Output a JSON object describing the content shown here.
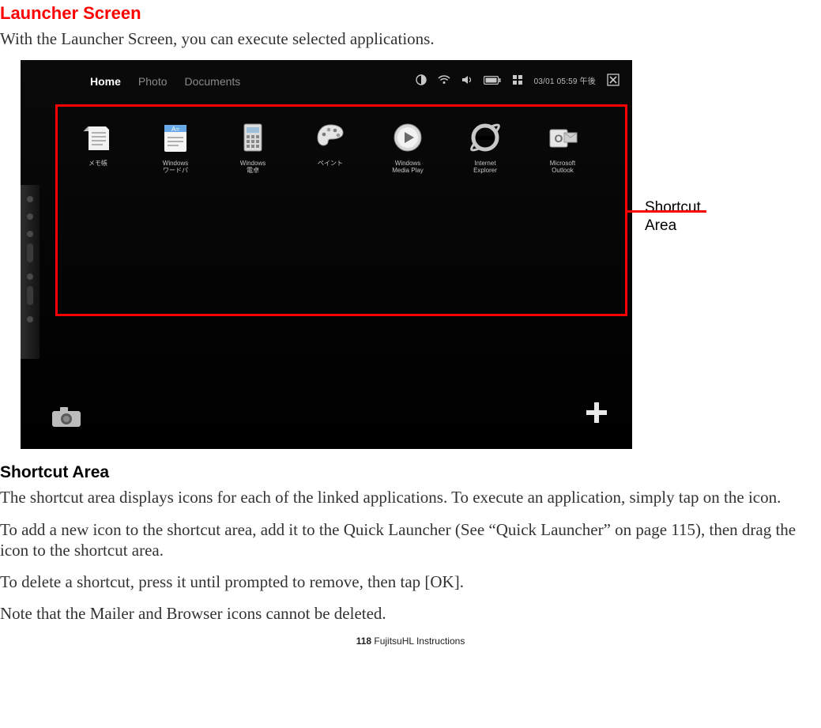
{
  "heading_red": "Launcher Screen",
  "intro": "With the Launcher Screen, you can execute selected applications.",
  "callout": "Shortcut\nArea",
  "topbar": {
    "tabs": [
      "Home",
      "Photo",
      "Documents"
    ]
  },
  "status": {
    "time": "03/01 05:59 午後"
  },
  "icons": [
    {
      "name": "notepad-icon",
      "label": "メモ帳"
    },
    {
      "name": "wordpad-icon",
      "label": "Windows\nワードパ"
    },
    {
      "name": "calculator-icon",
      "label": "Windows\n電卓"
    },
    {
      "name": "paint-icon",
      "label": "ペイント"
    },
    {
      "name": "media-player-icon",
      "label": "Windows\nMedia Play"
    },
    {
      "name": "internet-explorer-icon",
      "label": "Internet\nExplorer"
    },
    {
      "name": "outlook-icon",
      "label": "Microsoft\nOutlook"
    }
  ],
  "section2_heading": "Shortcut Area",
  "para1": "The shortcut area displays icons for each of the linked applications. To execute an application, simply tap on the icon.",
  "para2": "To add a new icon to the shortcut area, add it to the Quick Launcher (See “Quick Launcher” on page 115), then drag the icon to the shortcut area.",
  "para3": "To delete a shortcut, press it until prompted to remove, then tap [OK].",
  "para4": "Note that the Mailer and Browser icons cannot be deleted.",
  "footer": {
    "page_num": "118",
    "title": " FujitsuHL Instructions"
  }
}
